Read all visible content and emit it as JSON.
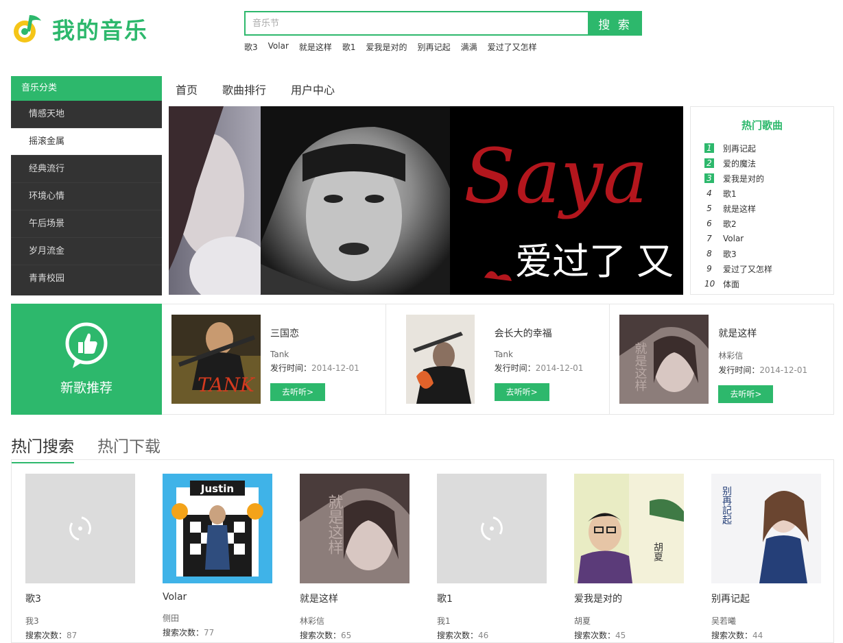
{
  "header": {
    "logo_text": "我的音乐",
    "search_placeholder": "音乐节",
    "search_button": "搜 索",
    "hot_words": [
      "歌3",
      "Volar",
      "就是这样",
      "歌1",
      "爱我是对的",
      "别再记起",
      "满满",
      "爱过了又怎样"
    ]
  },
  "categories": {
    "title": "音乐分类",
    "items": [
      "情感天地",
      "摇滚金属",
      "经典流行",
      "环境心情",
      "午后场景",
      "岁月流金",
      "青青校园"
    ],
    "active_index": 1
  },
  "nav": [
    "首页",
    "歌曲排行",
    "用户中心"
  ],
  "banner": {
    "script_text": "Saya",
    "caption": "爱过了 又"
  },
  "hot_songs": {
    "title": "热门歌曲",
    "items": [
      {
        "rank": "1",
        "name": "别再记起"
      },
      {
        "rank": "2",
        "name": "爱的魔法"
      },
      {
        "rank": "3",
        "name": "爱我是对的"
      },
      {
        "rank": "4",
        "name": "歌1"
      },
      {
        "rank": "5",
        "name": "就是这样"
      },
      {
        "rank": "6",
        "name": "歌2"
      },
      {
        "rank": "7",
        "name": "Volar"
      },
      {
        "rank": "8",
        "name": "歌3"
      },
      {
        "rank": "9",
        "name": "爱过了又怎样"
      },
      {
        "rank": "10",
        "name": "体面"
      }
    ]
  },
  "new_songs": {
    "label": "新歌推荐",
    "date_label": "发行时间：",
    "listen_label": "去听听>",
    "items": [
      {
        "title": "三国恋",
        "artist": "Tank",
        "date": "2014-12-01",
        "cover_text": "TANK"
      },
      {
        "title": "会长大的幸福",
        "artist": "Tank",
        "date": "2014-12-01"
      },
      {
        "title": "就是这样",
        "artist": "林彩信",
        "date": "2014-12-01",
        "cover_text": "就是这样"
      }
    ]
  },
  "tabs": [
    "热门搜索",
    "热门下载"
  ],
  "search_list": {
    "count_label": "搜索次数：",
    "items": [
      {
        "name": "歌3",
        "artist": "我3",
        "count": "87"
      },
      {
        "name": "Volar",
        "artist": "侧田",
        "count": "77",
        "cover_text": "Justin"
      },
      {
        "name": "就是这样",
        "artist": "林彩信",
        "count": "65",
        "cover_text": "就是这样"
      },
      {
        "name": "歌1",
        "artist": "我1",
        "count": "46"
      },
      {
        "name": "爱我是对的",
        "artist": "胡夏",
        "count": "45",
        "cover_text": "胡夏"
      },
      {
        "name": "别再记起",
        "artist": "吴若曦",
        "count": "44",
        "cover_text": "别再記起"
      }
    ]
  },
  "colors": {
    "accent": "#2db86c",
    "dark": "#333333"
  }
}
